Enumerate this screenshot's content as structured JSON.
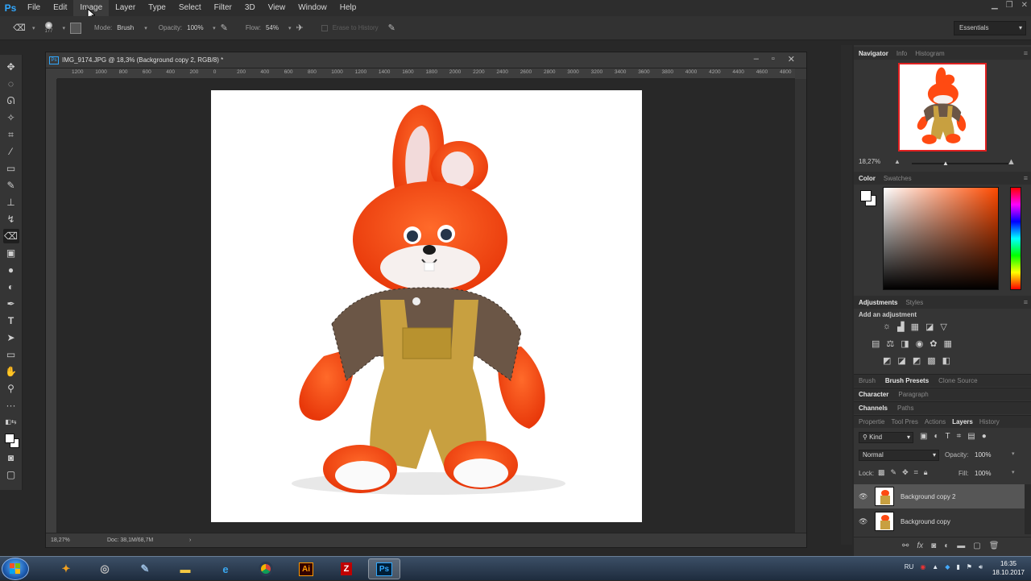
{
  "app": {
    "logo": "Ps"
  },
  "menu": [
    "File",
    "Edit",
    "Image",
    "Layer",
    "Type",
    "Select",
    "Filter",
    "3D",
    "View",
    "Window",
    "Help"
  ],
  "active_menu": "Image",
  "options": {
    "brush_size": "177",
    "mode_label": "Mode:",
    "mode_value": "Brush",
    "opacity_label": "Opacity:",
    "opacity_value": "100%",
    "flow_label": "Flow:",
    "flow_value": "54%",
    "erase_history": "Erase to History",
    "workspace": "Essentials"
  },
  "document": {
    "title": "IMG_9174.JPG @ 18,3% (Background copy 2, RGB/8) *",
    "ruler_ticks": [
      "1200",
      "1000",
      "800",
      "600",
      "400",
      "200",
      "0",
      "200",
      "400",
      "600",
      "800",
      "1000",
      "1200",
      "1400",
      "1600",
      "1800",
      "2000",
      "2200",
      "2400",
      "2600",
      "2800",
      "3000",
      "3200",
      "3400",
      "3600",
      "3800",
      "4000",
      "4200",
      "4400",
      "4600",
      "4800"
    ],
    "status_zoom": "18,27%",
    "status_doc": "Doc: 38,1M/68,7M"
  },
  "panels": {
    "navigator_tabs": [
      "Navigator",
      "Info",
      "Histogram"
    ],
    "navigator_zoom": "18,27%",
    "color_tabs": [
      "Color",
      "Swatches"
    ],
    "adjustments_tabs": [
      "Adjustments",
      "Styles"
    ],
    "add_adjustment": "Add an adjustment",
    "brush_tabs": [
      "Brush",
      "Brush Presets",
      "Clone Source"
    ],
    "character_tabs": [
      "Character",
      "Paragraph"
    ],
    "channels_tabs": [
      "Channels",
      "Paths"
    ],
    "layers_tabs": [
      "Propertie",
      "Tool Pres",
      "Actions",
      "Layers",
      "History"
    ],
    "kind_label": "Kind",
    "blend_mode": "Normal",
    "opacity_label": "Opacity:",
    "opacity_value": "100%",
    "lock_label": "Lock:",
    "fill_label": "Fill:",
    "fill_value": "100%",
    "layers": [
      "Background copy 2",
      "Background copy"
    ]
  },
  "taskbar": {
    "lang": "RU",
    "time": "16:35",
    "date": "18.10.2017"
  },
  "colors": {
    "accent": "#31a8ff",
    "nav_frame": "#e02020",
    "fur": "#ff4a12",
    "overalls": "#c8a040"
  }
}
